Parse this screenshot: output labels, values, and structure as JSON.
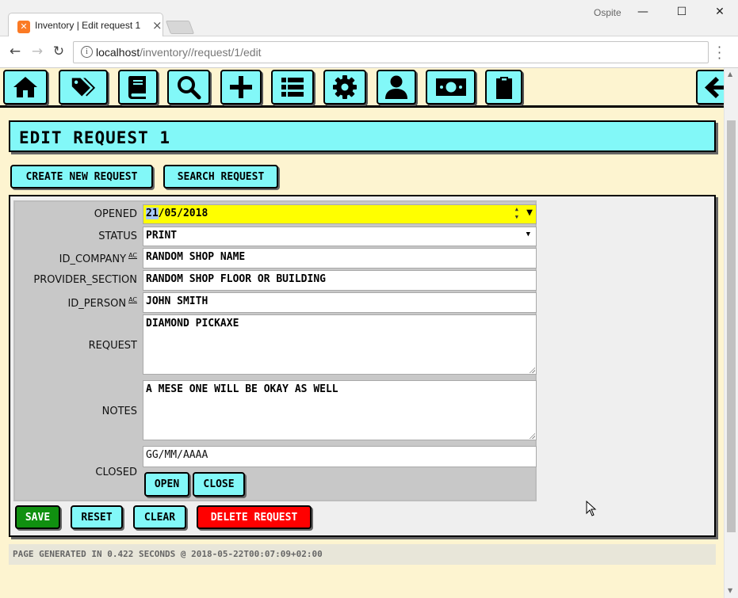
{
  "browser": {
    "tab_title": "Inventory | Edit request 1",
    "tab_close": "×",
    "profile": "Ospite",
    "url_host": "localhost",
    "url_path": "/inventory//request/1/edit",
    "window_controls": {
      "minimize": "—",
      "maximize": "☐",
      "close": "✕"
    },
    "nav": {
      "back": "←",
      "forward": "→",
      "reload": "↻"
    }
  },
  "toolbar": {
    "icons": [
      "home-icon",
      "tags-icon",
      "book-icon",
      "search-icon",
      "plus-icon",
      "list-icon",
      "gear-icon",
      "user-icon",
      "money-icon",
      "clipboard-icon",
      "arrow-left-icon"
    ]
  },
  "page": {
    "title": "EDIT REQUEST 1",
    "create_button": "CREATE NEW REQUEST",
    "search_button": "SEARCH REQUEST"
  },
  "form": {
    "opened": {
      "label": "OPENED",
      "value_day": "21",
      "value_rest": "/05/2018"
    },
    "status": {
      "label": "STATUS",
      "value": "PRINT"
    },
    "id_company": {
      "label": "ID_COMPANY",
      "ac": "AC",
      "value": "RANDOM SHOP NAME"
    },
    "provider_section": {
      "label": "PROVIDER_SECTION",
      "value": "RANDOM SHOP FLOOR OR BUILDING"
    },
    "id_person": {
      "label": "ID_PERSON",
      "ac": "AC",
      "value": "JOHN SMITH"
    },
    "request": {
      "label": "REQUEST",
      "value": "DIAMOND PICKAXE"
    },
    "notes": {
      "label": "NOTES",
      "value": "A MESE ONE WILL BE OKAY AS WELL"
    },
    "closed": {
      "label": "CLOSED",
      "placeholder": "GG/MM/AAAA",
      "open_button": "OPEN",
      "close_button": "CLOSE"
    }
  },
  "actions": {
    "save": "SAVE",
    "reset": "RESET",
    "clear": "CLEAR",
    "delete": "DELETE REQUEST"
  },
  "footer": {
    "text": "PAGE GENERATED IN 0.422 SECONDS @ 2018-05-22T00:07:09+02:00"
  },
  "colors": {
    "accent_cyan": "#82f8f8",
    "page_background": "#fdf4d0",
    "date_field": "#ffff00",
    "save": "#109010",
    "delete": "#ff0000"
  }
}
